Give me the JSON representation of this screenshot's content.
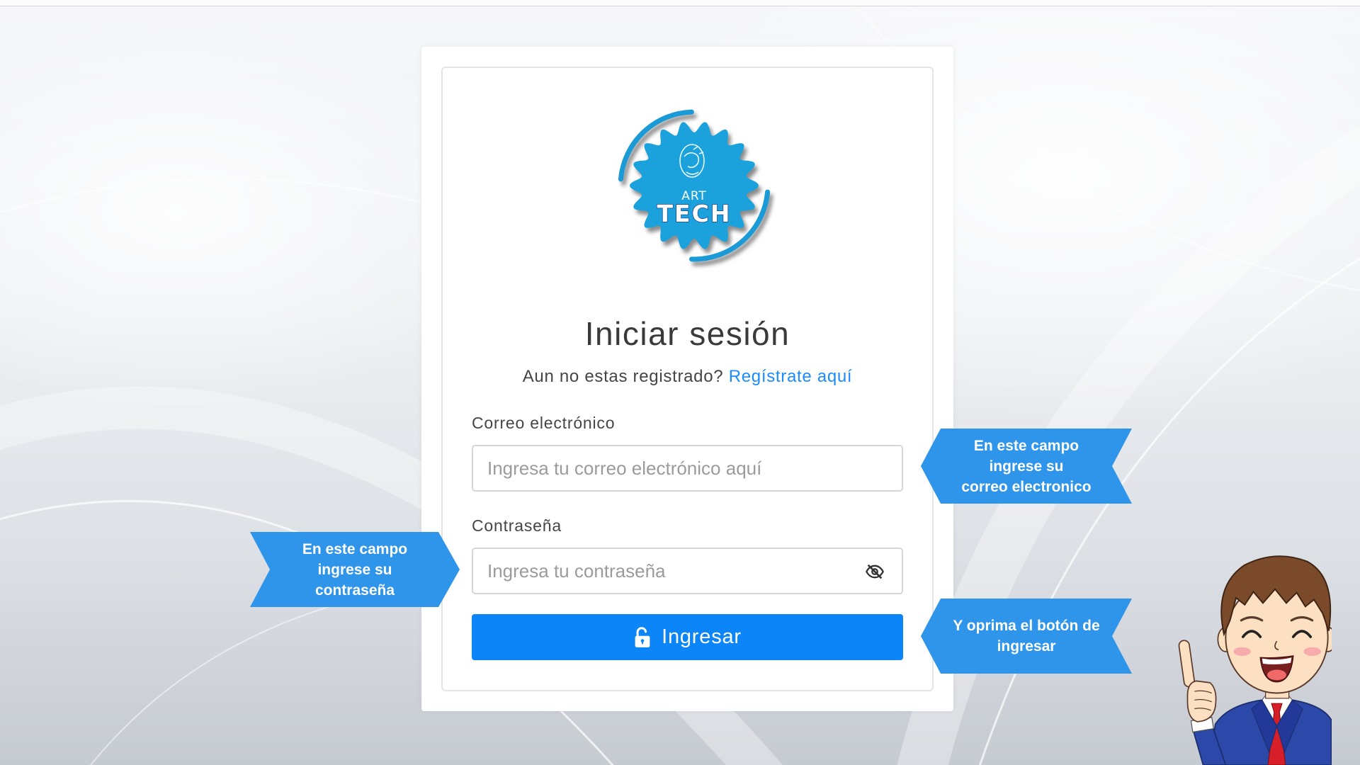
{
  "logo": {
    "line1": "ART",
    "line2": "TECH"
  },
  "login": {
    "title": "Iniciar sesión",
    "register_prompt": "Aun no estas registrado?",
    "register_link": "Regístrate aquí",
    "email_label": "Correo electrónico",
    "email_placeholder": "Ingresa tu correo electrónico aquí",
    "email_value": "",
    "password_label": "Contraseña",
    "password_placeholder": "Ingresa tu contraseña",
    "password_value": "",
    "password_toggle_icon": "eye-off-icon",
    "submit_label": "Ingresar",
    "submit_icon": "lock-open-icon"
  },
  "callouts": {
    "email": {
      "lines": [
        "En este campo",
        "ingrese su",
        "correo electronico"
      ]
    },
    "password": {
      "lines": [
        "En este campo",
        "ingrese su",
        "contraseña"
      ]
    },
    "submit": {
      "lines": [
        "Y oprima el botón de",
        "ingresar"
      ]
    }
  },
  "colors": {
    "primary_button": "#0b85f7",
    "link": "#1a8cff",
    "callout": "#2f95ea",
    "logo": "#1ba2dc"
  }
}
